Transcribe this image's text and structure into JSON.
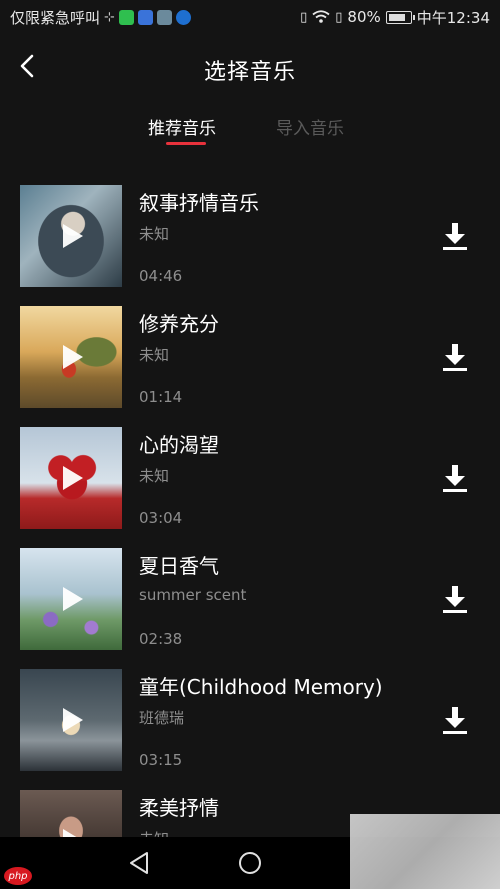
{
  "status_bar": {
    "left_text": "仅限紧急呼叫",
    "battery_percent": "80%",
    "time": "中午12:34",
    "app_icons": [
      "plus-minus-icon",
      "wechat-icon",
      "baidu-icon",
      "album-icon",
      "swirl-app-icon"
    ],
    "right_icons": [
      "vibrate-icon",
      "wifi-icon",
      "battery-saver-icon",
      "battery-icon"
    ]
  },
  "header": {
    "title": "选择音乐"
  },
  "tabs": [
    {
      "label": "推荐音乐",
      "active": true
    },
    {
      "label": "导入音乐",
      "active": false
    }
  ],
  "accent_color": "#e8323c",
  "songs": [
    {
      "title": "叙事抒情音乐",
      "artist": "未知",
      "duration": "04:46"
    },
    {
      "title": "修养充分",
      "artist": "未知",
      "duration": "01:14"
    },
    {
      "title": "心的渴望",
      "artist": "未知",
      "duration": "03:04"
    },
    {
      "title": "夏日香气",
      "artist": "summer scent",
      "duration": "02:38"
    },
    {
      "title": "童年(Childhood Memory)",
      "artist": "班德瑞",
      "duration": "03:15"
    },
    {
      "title": "柔美抒情",
      "artist": "未知",
      "duration": ""
    }
  ],
  "navbar": {
    "icons": [
      "nav-back-icon",
      "nav-home-icon"
    ]
  },
  "watermark": {
    "logo_text": "php"
  }
}
